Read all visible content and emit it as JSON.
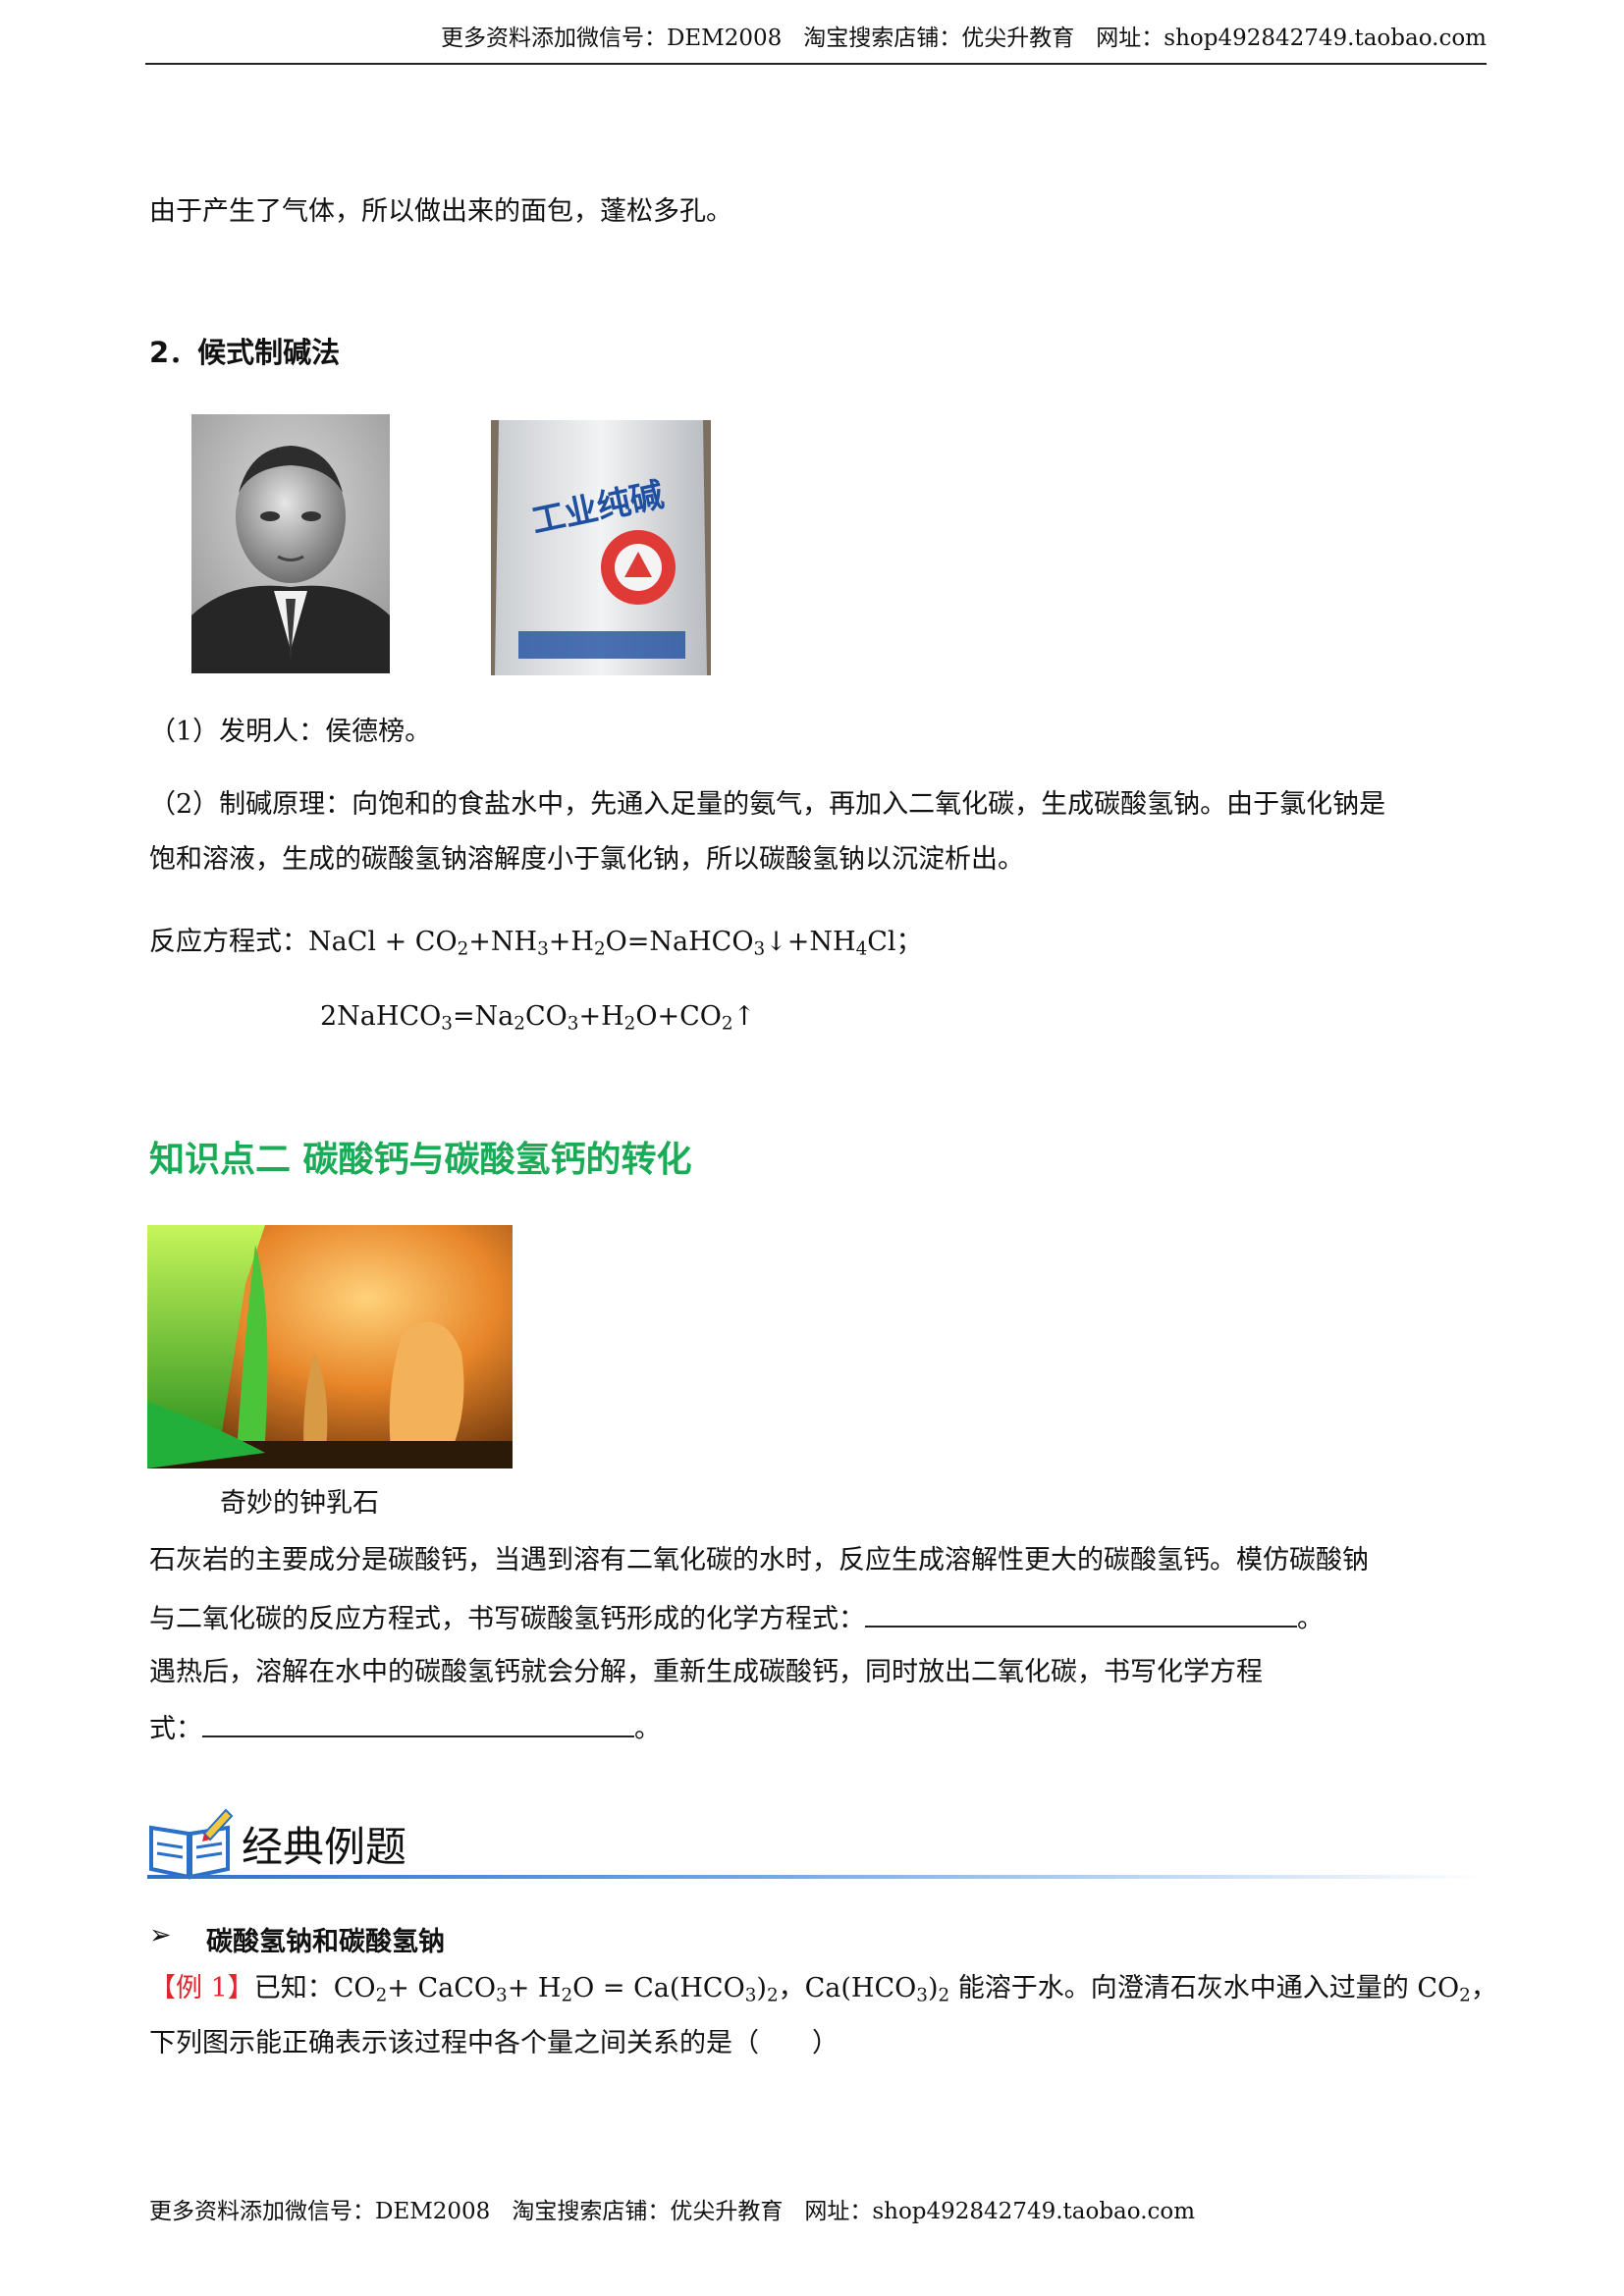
{
  "header": {
    "wechat": "更多资料添加微信号：DEM2008",
    "taobao": "淘宝搜索店铺：优尖升教育",
    "site": "网址：shop492842749.taobao.com"
  },
  "intro_line": "由于产生了气体，所以做出来的面包，蓬松多孔。",
  "section2": {
    "title": "2．候式制碱法",
    "bag_text": "工业纯碱",
    "inventor": "（1）发明人：侯德榜。",
    "principle_line1": "（2）制碱原理：向饱和的食盐水中，先通入足量的氨气，再加入二氧化碳，生成碳酸氢钠。由于氯化钠是",
    "principle_line2": "饱和溶液，生成的碳酸氢钠溶解度小于氯化钠，所以碳酸氢钠以沉淀析出。",
    "eq_label": "反应方程式："
  },
  "kp2": {
    "title": "知识点二  碳酸钙与碳酸氢钙的转化",
    "caption": "奇妙的钟乳石",
    "line1": "石灰岩的主要成分是碳酸钙，当遇到溶有二氧化碳的水时，反应生成溶解性更大的碳酸氢钙。模仿碳酸钠",
    "line2_pre": "与二氧化碳的反应方程式，书写碳酸氢钙形成的化学方程式：",
    "line2_post": "。",
    "line3": "遇热后，溶解在水中的碳酸氢钙就会分解，重新生成碳酸钙，同时放出二氧化碳，书写化学方程",
    "line4_pre": "式：",
    "line4_post": "。"
  },
  "classic": {
    "title": "经典例题",
    "bullet": "碳酸氢钠和碳酸氢钠",
    "example_tag": "【例 1】",
    "example_line2": "下列图示能正确表示该过程中各个量之间关系的是（　　）"
  },
  "colors": {
    "green": "#1aab56",
    "red": "#e0262b",
    "banner_blue": "#2a6fc9"
  }
}
